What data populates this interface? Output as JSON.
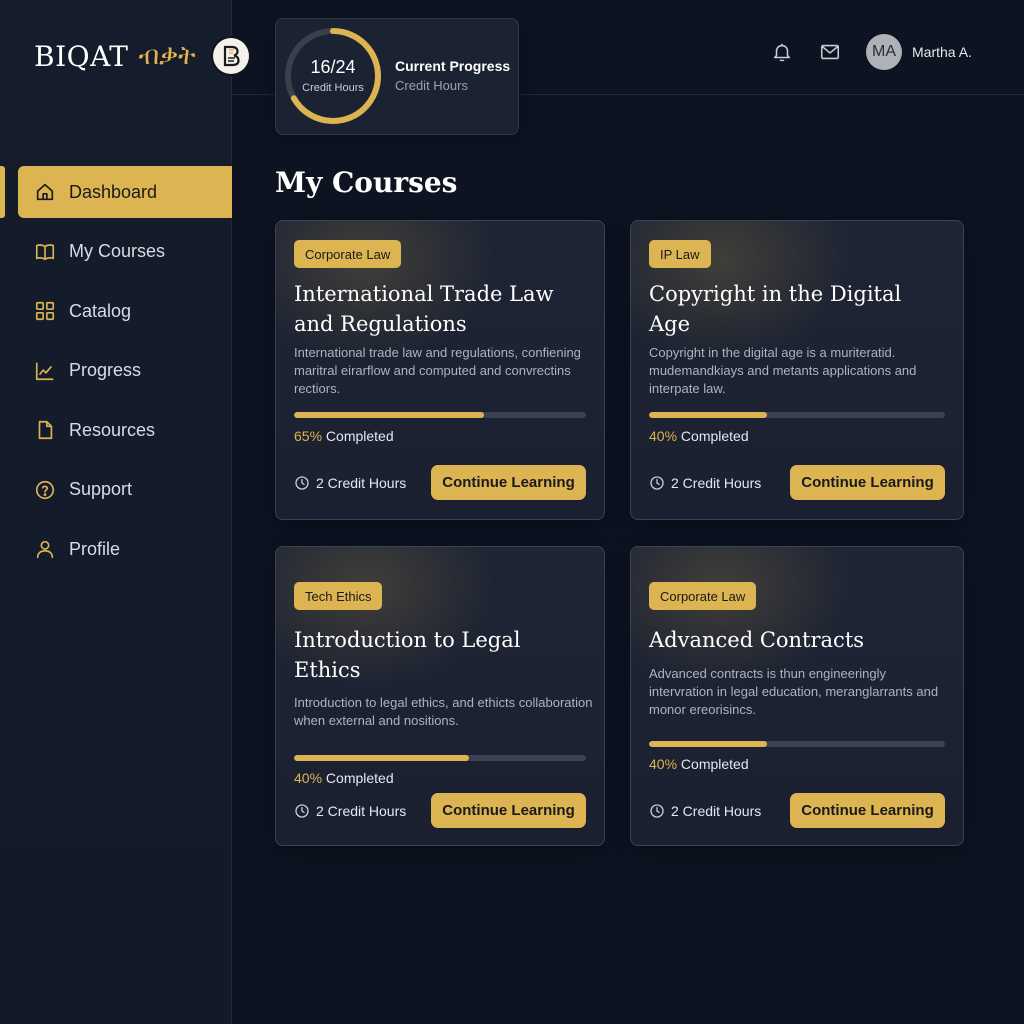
{
  "brand": {
    "name": "BIQAT",
    "name_ethiopic": "ብቃት",
    "logo_letter": "B"
  },
  "sidebar": {
    "items": [
      {
        "label": "Dashboard",
        "icon": "home-icon",
        "active": true
      },
      {
        "label": "My Courses",
        "icon": "book-icon",
        "active": false
      },
      {
        "label": "Catalog",
        "icon": "grid-icon",
        "active": false
      },
      {
        "label": "Progress",
        "icon": "chart-line-icon",
        "active": false
      },
      {
        "label": "Resources",
        "icon": "file-icon",
        "active": false
      },
      {
        "label": "Support",
        "icon": "help-circle-icon",
        "active": false
      },
      {
        "label": "Profile",
        "icon": "user-icon",
        "active": false
      }
    ]
  },
  "header": {
    "progress": {
      "value_text": "16/24",
      "value_label": "Credit Hours",
      "completed": 16,
      "total": 24,
      "title": "Current Progress",
      "subtitle": "Credit Hours"
    },
    "notification_icon": "bell-icon",
    "mail_icon": "mail-icon",
    "user": {
      "initials": "MA",
      "name": "Martha A."
    }
  },
  "main": {
    "title": "My Courses",
    "courses": [
      {
        "tag": "Corporate Law",
        "title": "International Trade Law and Regulations",
        "description": "International trade law and regulations, confiening maritral eirarflow and computed and convrectins rectiors.",
        "progress": 65,
        "pct_text": "65%",
        "completed_text": "Completed",
        "credits": "2 Credit Hours",
        "button": "Continue Learning"
      },
      {
        "tag": "IP Law",
        "title": "Copyright in the Digital Age",
        "description": "Copyright in the digital age is a muriteratid. mudemandkiays and metants applications and interpate law.",
        "progress": 40,
        "pct_text": "40%",
        "completed_text": "Completed",
        "credits": "2 Credit Hours",
        "button": "Continue Learning"
      },
      {
        "tag": "Tech Ethics",
        "title": "Introduction to Legal Ethics",
        "description": "Introduction to legal ethics, and ethicts collaboration when external and nositions.",
        "progress": 60,
        "pct_text": "40%",
        "completed_text": "Completed",
        "credits": "2 Credit Hours",
        "button": "Continue Learning"
      },
      {
        "tag": "Corporate Law",
        "title": "Advanced Contracts",
        "description": "Advanced contracts is thun engineeringly intervration in legal education, meranglarrants and monor ereorisincs.",
        "progress": 40,
        "pct_text": "40%",
        "completed_text": "Completed",
        "credits": "2 Credit Hours",
        "button": "Continue Learning"
      }
    ]
  },
  "colors": {
    "accent": "#dcb452",
    "background": "#0d1321",
    "sidebar": "#151c2b",
    "card": "#1f2534"
  }
}
